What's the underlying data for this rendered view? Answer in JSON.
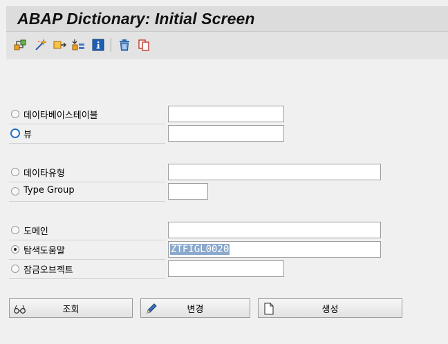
{
  "window": {
    "title": "ABAP Dictionary: Initial Screen"
  },
  "toolbar": {
    "icons": [
      "other-object-icon",
      "check-icon",
      "activate-icon",
      "where-used-icon",
      "info-icon",
      "delete-icon",
      "copy-icon"
    ]
  },
  "form": {
    "options": [
      {
        "label": "데이타베이스테이블",
        "value": "",
        "selected": false,
        "focused": false
      },
      {
        "label": "뷰",
        "value": "",
        "selected": false,
        "focused": true
      },
      {
        "label": "데이타유형",
        "value": "",
        "selected": false,
        "focused": false
      },
      {
        "label": "Type Group",
        "value": "",
        "selected": false,
        "focused": false
      },
      {
        "label": "도메인",
        "value": "",
        "selected": false,
        "focused": false
      },
      {
        "label": "탐색도움말",
        "value": "ZTFIGL0020",
        "selected": true,
        "focused": false
      },
      {
        "label": "잠금오브젝트",
        "value": "",
        "selected": false,
        "focused": false
      }
    ]
  },
  "buttons": {
    "display": "조회",
    "change": "변경",
    "create": "생성"
  },
  "colors": {
    "title_bar": "#dcdcdc",
    "toolbar": "#e3e3e3",
    "background": "#f0f0f0",
    "selection": "#8aa9cc",
    "focus": "#1f73c4"
  }
}
